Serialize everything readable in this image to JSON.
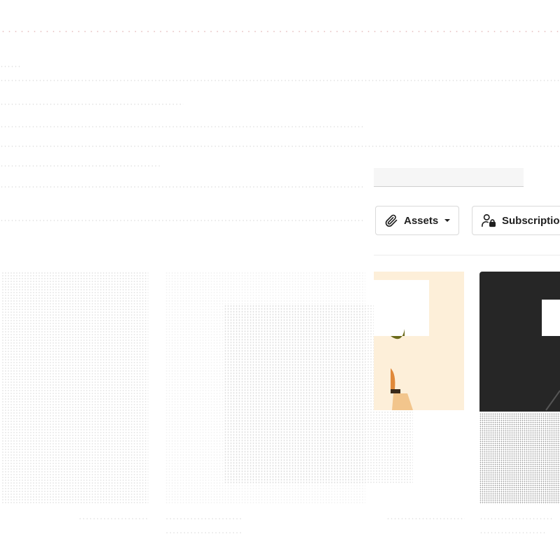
{
  "filters": {
    "assets_label": "Assets",
    "subscriptions_label": "Subscriptio"
  },
  "icons": {
    "paperclip": "paperclip-icon",
    "caret_down": "caret-down-icon",
    "user_lock": "user-lock-icon"
  },
  "colors": {
    "card_a_bg": "#fdefd9",
    "card_b_bg": "#262626",
    "accent_orange": "#e0893a",
    "accent_olive": "#6b6a1a"
  }
}
